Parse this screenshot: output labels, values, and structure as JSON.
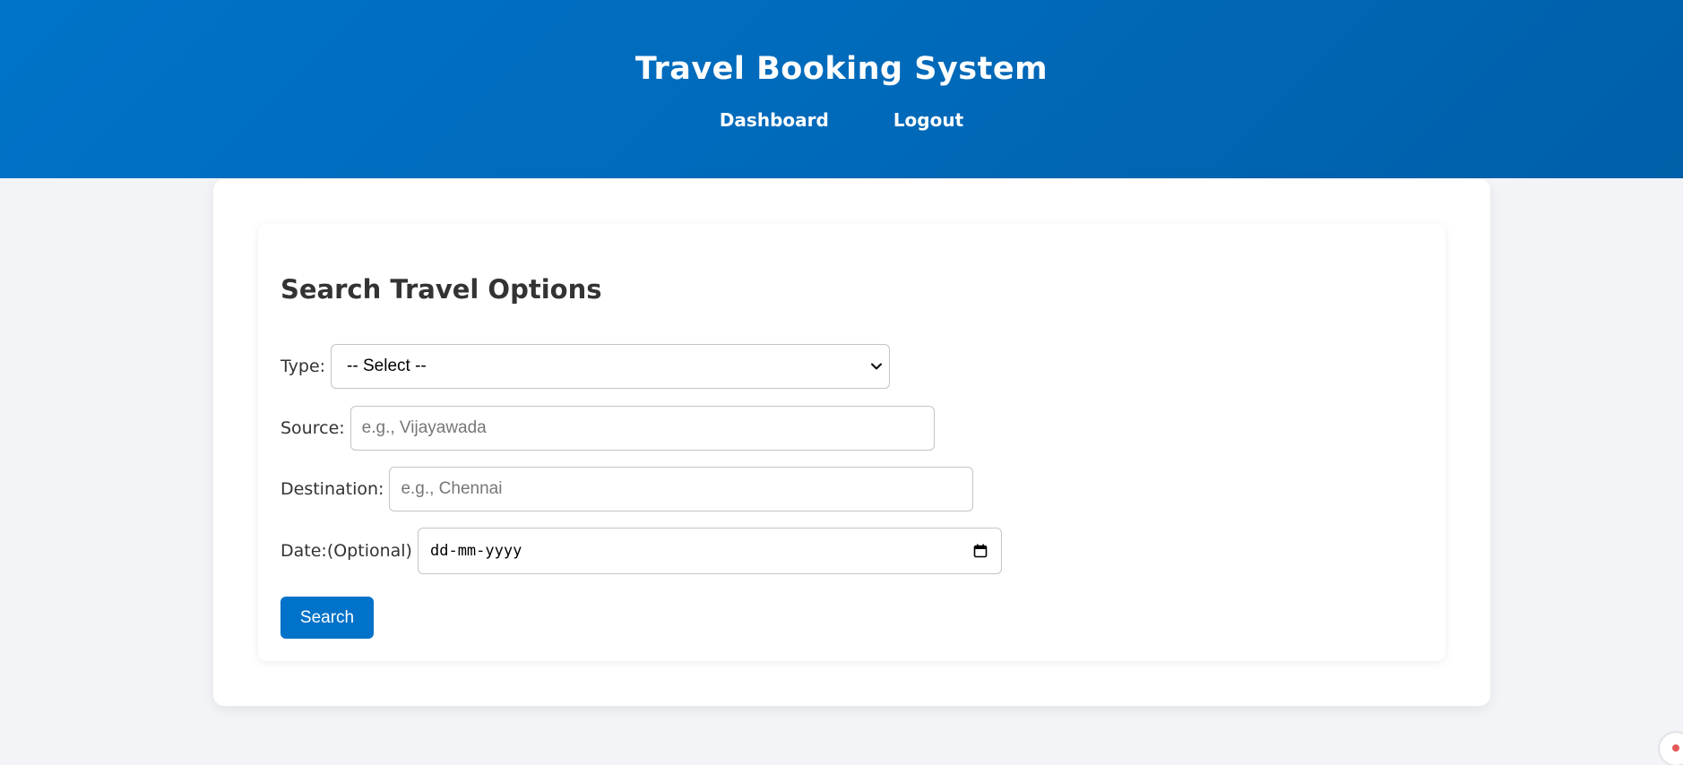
{
  "header": {
    "title": "Travel Booking System",
    "nav": [
      {
        "label": "Dashboard"
      },
      {
        "label": "Logout"
      }
    ]
  },
  "search": {
    "heading": "Search Travel Options",
    "type": {
      "label": "Type:",
      "selected": "-- Select --",
      "icon": "chevron-down-icon"
    },
    "source": {
      "label": "Source:",
      "value": "",
      "placeholder": "e.g., Vijayawada"
    },
    "destination": {
      "label": "Destination:",
      "value": "",
      "placeholder": "e.g., Chennai"
    },
    "date": {
      "label": "Date:(Optional)",
      "value": "dd-mm-yyyy",
      "icon": "calendar-icon"
    },
    "submit_label": "Search"
  },
  "colors": {
    "header_gradient_start": "#0073c8",
    "header_gradient_end": "#005fa8",
    "button_bg": "#0172c9",
    "page_bg": "#f3f4f8",
    "text_dark": "#333333"
  }
}
